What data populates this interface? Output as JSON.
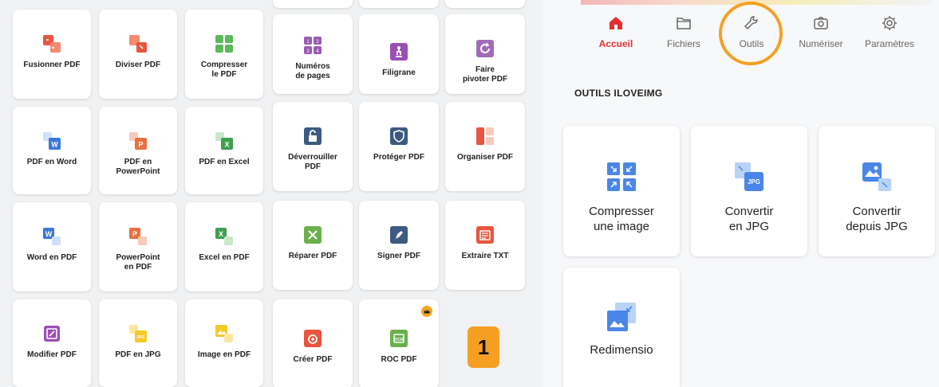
{
  "panel_left": {
    "tiles": [
      {
        "label": "Fusionner PDF",
        "icon": "merge-pdf-icon"
      },
      {
        "label": "Diviser PDF",
        "icon": "split-pdf-icon"
      },
      {
        "label": "Compresser\nle PDF",
        "icon": "compress-pdf-icon"
      },
      {
        "label": "PDF en Word",
        "icon": "pdf-to-word-icon"
      },
      {
        "label": "PDF en\nPowerPoint",
        "icon": "pdf-to-powerpoint-icon"
      },
      {
        "label": "PDF en Excel",
        "icon": "pdf-to-excel-icon"
      },
      {
        "label": "Word en PDF",
        "icon": "word-to-pdf-icon"
      },
      {
        "label": "PowerPoint\nen PDF",
        "icon": "powerpoint-to-pdf-icon"
      },
      {
        "label": "Excel en PDF",
        "icon": "excel-to-pdf-icon"
      },
      {
        "label": "Modifier PDF",
        "icon": "edit-pdf-icon"
      },
      {
        "label": "PDF en JPG",
        "icon": "pdf-to-jpg-icon"
      },
      {
        "label": "Image en PDF",
        "icon": "image-to-pdf-icon"
      }
    ]
  },
  "panel_middle": {
    "tiles": [
      {
        "label": "Numéros\nde pages",
        "icon": "page-numbers-icon"
      },
      {
        "label": "Filigrane",
        "icon": "watermark-icon"
      },
      {
        "label": "Faire\npivoter PDF",
        "icon": "rotate-pdf-icon"
      },
      {
        "label": "Déverrouiller\nPDF",
        "icon": "unlock-pdf-icon"
      },
      {
        "label": "Protéger PDF",
        "icon": "protect-pdf-icon"
      },
      {
        "label": "Organiser PDF",
        "icon": "organize-pdf-icon"
      },
      {
        "label": "Réparer PDF",
        "icon": "repair-pdf-icon"
      },
      {
        "label": "Signer PDF",
        "icon": "sign-pdf-icon"
      },
      {
        "label": "Extraire TXT",
        "icon": "extract-txt-icon"
      },
      {
        "label": "Créer PDF",
        "icon": "create-pdf-icon"
      },
      {
        "label": "ROC PDF",
        "icon": "ocr-pdf-icon"
      }
    ],
    "step_badge": "1",
    "premium_icon": "crown-icon"
  },
  "panel_right": {
    "nav": [
      {
        "label": "Accueil",
        "icon": "home-icon",
        "active": true
      },
      {
        "label": "Fichiers",
        "icon": "folder-icon",
        "active": false
      },
      {
        "label": "Outils",
        "icon": "wrench-icon",
        "active": false
      },
      {
        "label": "Numériser",
        "icon": "camera-icon",
        "active": false
      },
      {
        "label": "Paramètres",
        "icon": "gear-icon",
        "active": false
      }
    ],
    "section_title": "OUTILS ILOVEIMG",
    "tools": [
      {
        "label": "Compresser\nune image",
        "icon": "compress-image-icon"
      },
      {
        "label": "Convertir\nen JPG",
        "icon": "convert-to-jpg-icon"
      },
      {
        "label": "Convertir\ndepuis JPG",
        "icon": "convert-from-jpg-icon"
      },
      {
        "label": "Redimensio",
        "icon": "resize-image-icon"
      }
    ],
    "jpg_badge": "JPG"
  },
  "colors": {
    "accent_red": "#e23030",
    "highlight_orange": "#f5a023",
    "icon_blue": "#4a86e8"
  }
}
